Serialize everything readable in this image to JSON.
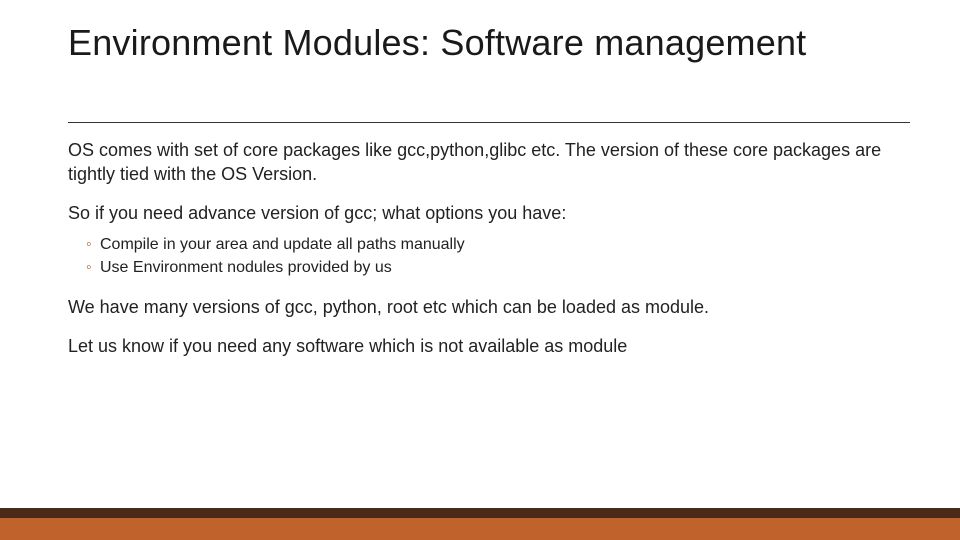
{
  "title": "Environment Modules: Software management",
  "body": {
    "p1": "OS comes with set of core packages like gcc,python,glibc etc. The version of these core packages are tightly tied with the OS Version.",
    "p2": "So if you need advance version of gcc; what options you have:",
    "bullets": [
      "Compile in your area and update all paths manually",
      "Use Environment nodules provided by us"
    ],
    "p3": "We have many versions of gcc, python, root etc which can be loaded as module.",
    "p4": "Let us know if you need any software which is not available as module"
  },
  "accent_color": "#c0622c"
}
